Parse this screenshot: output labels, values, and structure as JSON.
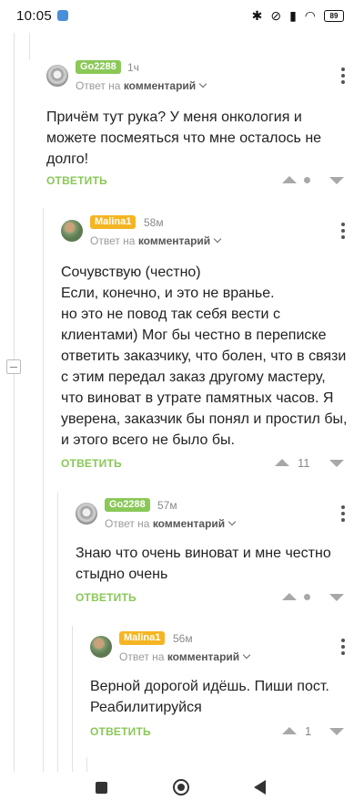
{
  "status_bar": {
    "time": "10:05",
    "battery": "89"
  },
  "comments": [
    {
      "author": "Go2288",
      "time": "1ч",
      "reply_prefix": "Ответ на",
      "reply_target": "комментарий",
      "text": "Причём тут рука? У меня онкология и можете посмеяться что мне осталось не долго!",
      "reply_label": "ОТВЕТИТЬ",
      "rating": ""
    },
    {
      "author": "Malina1",
      "time": "58м",
      "reply_prefix": "Ответ на",
      "reply_target": "комментарий",
      "text": "Сочувствую (честно)\nЕсли, конечно, и это не вранье.\nно это не повод так себя вести с клиентами) Мог бы честно в переписке ответить заказчику, что болен, что в связи с этим передал заказ другому мастеру, что виноват в утрате памятных часов. Я уверена, заказчик бы понял и простил бы, и этого всего не было бы.",
      "reply_label": "ОТВЕТИТЬ",
      "rating": "11"
    },
    {
      "author": "Go2288",
      "time": "57м",
      "reply_prefix": "Ответ на",
      "reply_target": "комментарий",
      "text": "Знаю что очень виноват и мне честно стыдно очень",
      "reply_label": "ОТВЕТИТЬ",
      "rating": ""
    },
    {
      "author": "Malina1",
      "time": "56м",
      "reply_prefix": "Ответ на",
      "reply_target": "комментарий",
      "text": "Верной дорогой идёшь. Пиши пост. Реабилитируйся",
      "reply_label": "ОТВЕТИТЬ",
      "rating": "1"
    }
  ]
}
